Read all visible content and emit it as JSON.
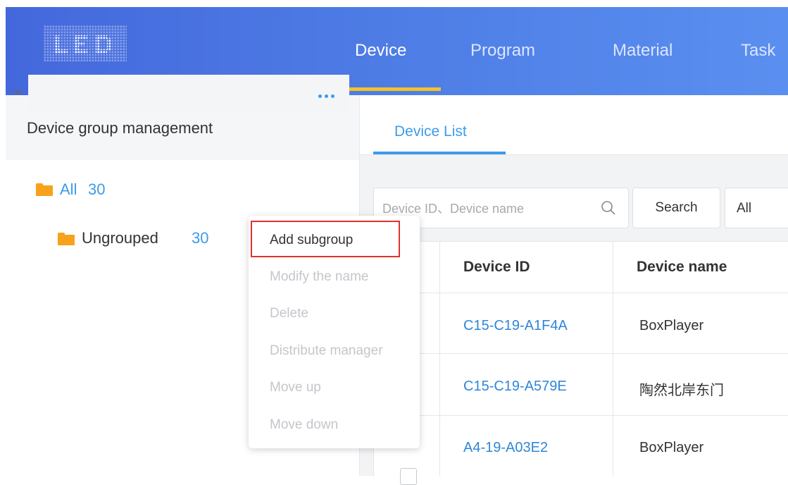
{
  "nav": {
    "items": [
      {
        "label": "Device"
      },
      {
        "label": "Program"
      },
      {
        "label": "Material"
      },
      {
        "label": "Task"
      }
    ]
  },
  "left_panel": {
    "title": "Device group management",
    "tree": [
      {
        "label": "All",
        "count": "30"
      },
      {
        "label": "Ungrouped",
        "count": "30"
      }
    ]
  },
  "context_menu": {
    "items": [
      {
        "label": "Add subgroup"
      },
      {
        "label": "Modify the name"
      },
      {
        "label": "Delete"
      },
      {
        "label": "Distribute manager"
      },
      {
        "label": "Move up"
      },
      {
        "label": "Move down"
      }
    ]
  },
  "device_list": {
    "tab_label": "Device List",
    "search_placeholder": "Device ID、Device name",
    "search_button": "Search",
    "filter_value": "All",
    "columns": [
      "Device ID",
      "Device name"
    ],
    "rows": [
      {
        "device_id": "C15-C19-A1F4A",
        "device_name": "BoxPlayer"
      },
      {
        "device_id": "C15-C19-A579E",
        "device_name": "陶然北岸东门"
      },
      {
        "device_id": "A4-19-A03E2",
        "device_name": "BoxPlayer"
      }
    ]
  },
  "colors": {
    "header_start": "#4468dc",
    "header_end": "#5a8ff0",
    "accent_blue": "#3d9be9",
    "nav_underline": "#f6c12b",
    "folder": "#f7a21b",
    "highlight_border": "#e2312c"
  }
}
